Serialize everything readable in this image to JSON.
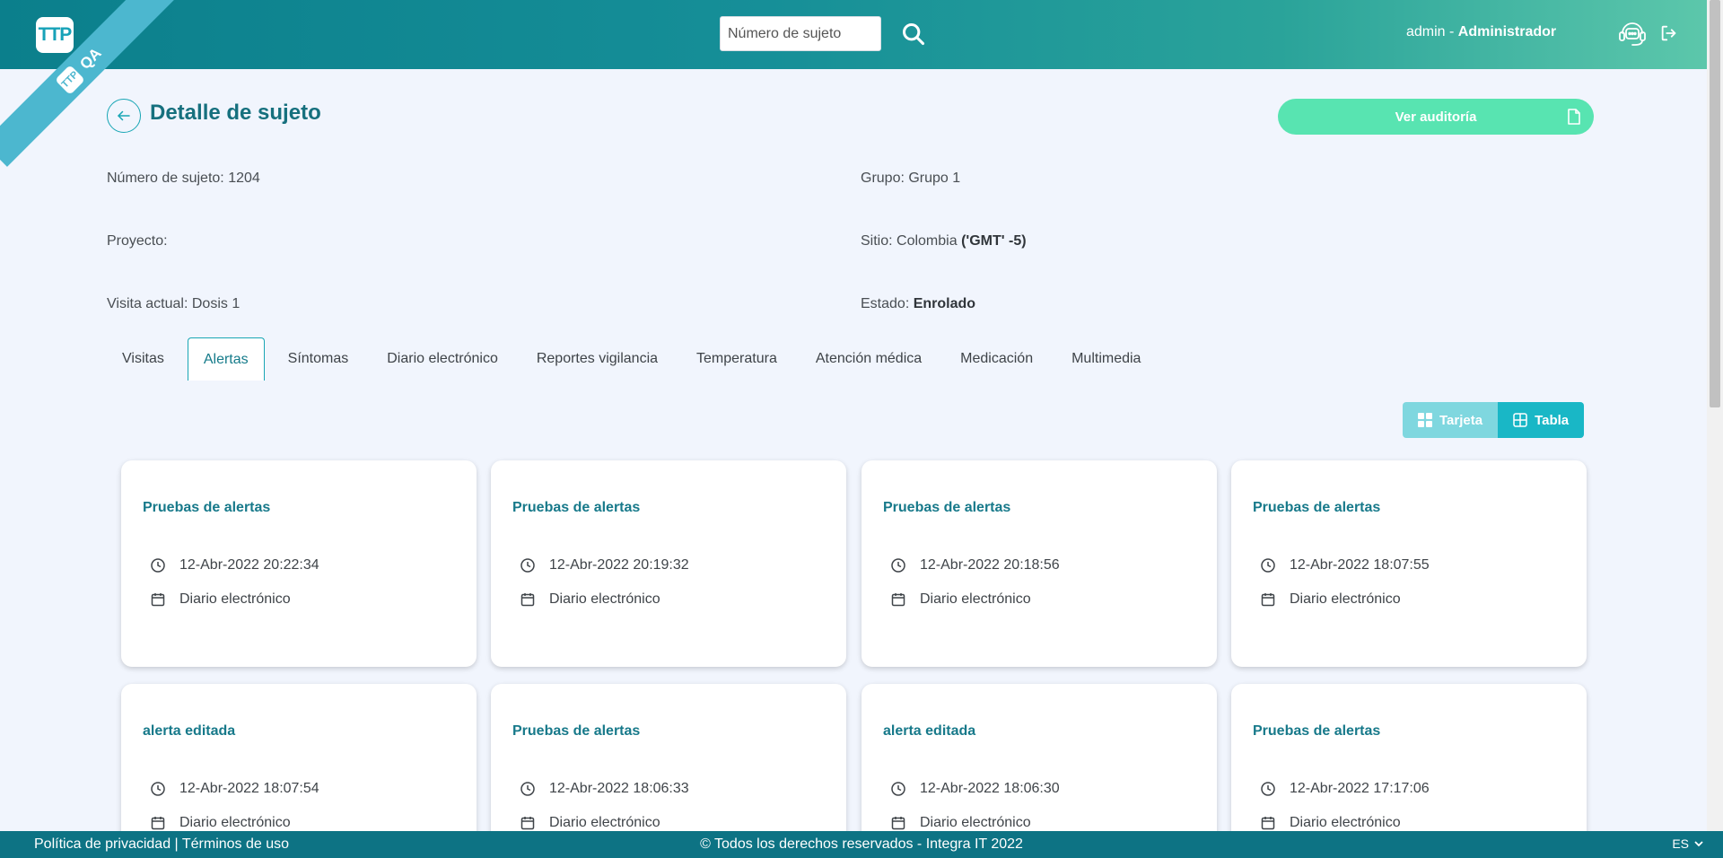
{
  "header": {
    "logo_text": "TTP",
    "env_badge": "QA",
    "search_placeholder": "Número de sujeto",
    "user_name": "admin",
    "user_separator": " - ",
    "user_role": "Administrador"
  },
  "page": {
    "title": "Detalle de sujeto",
    "audit_button": "Ver auditoría"
  },
  "info": {
    "subject_label": "Número de sujeto: ",
    "subject_value": "1204",
    "group_label": "Grupo: ",
    "group_value": "Grupo 1",
    "project_label": "Proyecto:",
    "site_label": "Sitio: ",
    "site_value": "Colombia",
    "site_tz": "('GMT' -5)",
    "visit_label": "Visita actual: ",
    "visit_value": "Dosis 1",
    "status_label": "Estado: ",
    "status_value": "Enrolado"
  },
  "tabs": [
    {
      "label": "Visitas",
      "active": false
    },
    {
      "label": "Alertas",
      "active": true
    },
    {
      "label": "Síntomas",
      "active": false
    },
    {
      "label": "Diario electrónico",
      "active": false
    },
    {
      "label": "Reportes vigilancia",
      "active": false
    },
    {
      "label": "Temperatura",
      "active": false
    },
    {
      "label": "Atención médica",
      "active": false
    },
    {
      "label": "Medicación",
      "active": false
    },
    {
      "label": "Multimedia",
      "active": false
    }
  ],
  "view_toggle": {
    "card_label": "Tarjeta",
    "table_label": "Tabla"
  },
  "cards": [
    {
      "title": "Pruebas de alertas",
      "datetime": "12-Abr-2022 20:22:34",
      "source": "Diario electrónico"
    },
    {
      "title": "Pruebas de alertas",
      "datetime": "12-Abr-2022 20:19:32",
      "source": "Diario electrónico"
    },
    {
      "title": "Pruebas de alertas",
      "datetime": "12-Abr-2022 20:18:56",
      "source": "Diario electrónico"
    },
    {
      "title": "Pruebas de alertas",
      "datetime": "12-Abr-2022 18:07:55",
      "source": "Diario electrónico"
    },
    {
      "title": "alerta editada",
      "datetime": "12-Abr-2022 18:07:54",
      "source": "Diario electrónico"
    },
    {
      "title": "Pruebas de alertas",
      "datetime": "12-Abr-2022 18:06:33",
      "source": "Diario electrónico"
    },
    {
      "title": "alerta editada",
      "datetime": "12-Abr-2022 18:06:30",
      "source": "Diario electrónico"
    },
    {
      "title": "Pruebas de alertas",
      "datetime": "12-Abr-2022 17:17:06",
      "source": "Diario electrónico"
    }
  ],
  "footer": {
    "privacy": "Política de privacidad",
    "separator": " | ",
    "terms": "Términos de uso",
    "copyright": "© Todos los derechos reservados - Integra IT 2022",
    "language": "ES"
  },
  "colors": {
    "accent": "#19a6b5",
    "title": "#16707e",
    "audit_button": "#58e4b1",
    "footer": "#0d7384"
  }
}
